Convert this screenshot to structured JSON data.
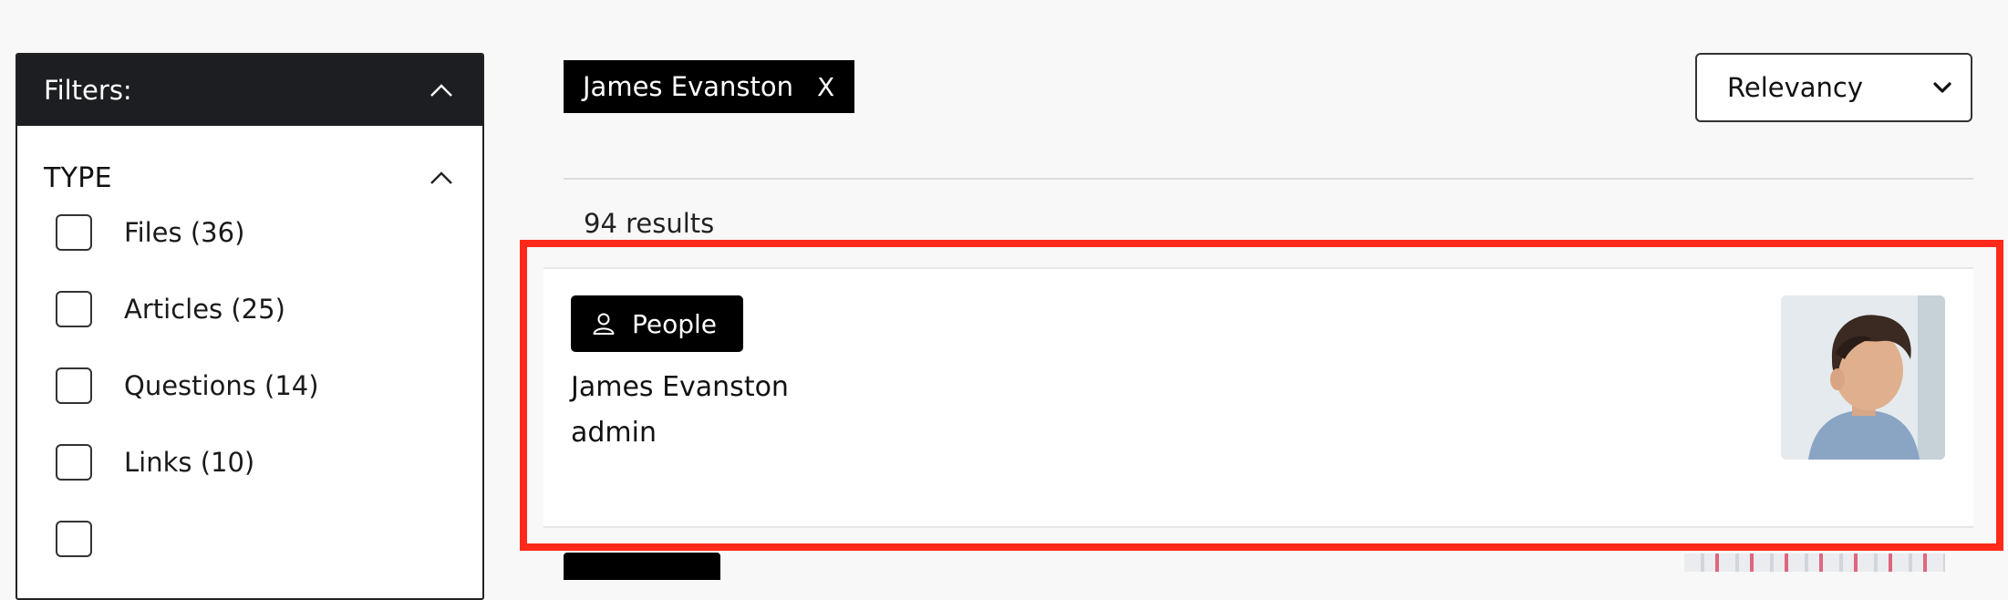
{
  "filters": {
    "title": "Filters:",
    "type": {
      "title": "TYPE",
      "options": [
        {
          "label": "Files (36)"
        },
        {
          "label": "Articles (25)"
        },
        {
          "label": "Questions (14)"
        },
        {
          "label": "Links (10)"
        }
      ]
    }
  },
  "active_tag": {
    "label": "James Evanston",
    "remove": "X"
  },
  "sort": {
    "selected": "Relevancy"
  },
  "results": {
    "count_text": "94 results",
    "items": [
      {
        "badge": "People",
        "name": "James Evanston",
        "role": "admin"
      }
    ]
  },
  "colors": {
    "dark": "#1d1e22",
    "highlight": "#ff2a1a",
    "badge": "#000000"
  },
  "icons": [
    "chevron-up-icon",
    "chevron-down-icon",
    "person-icon",
    "close-icon"
  ]
}
